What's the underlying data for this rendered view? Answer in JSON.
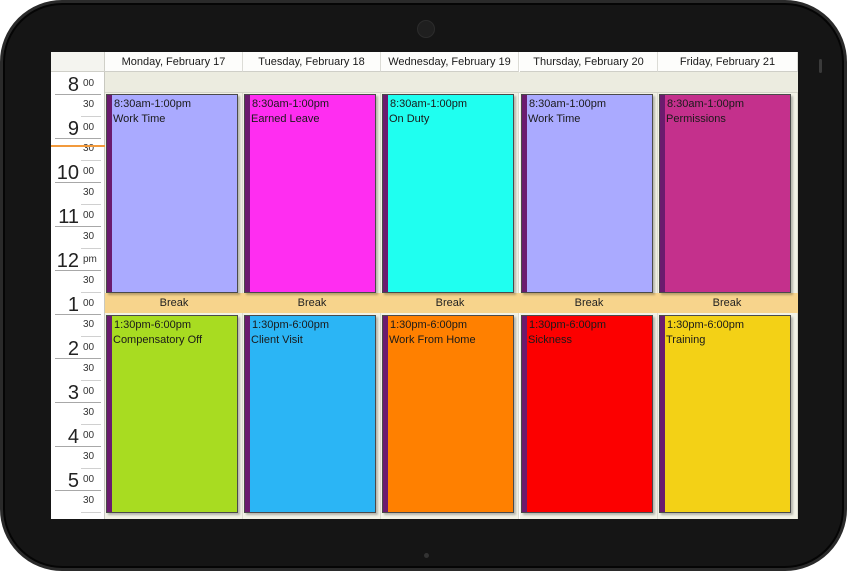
{
  "days": [
    {
      "header": "Monday, February 17",
      "morning": {
        "time": "8:30am-1:00pm",
        "subject": "Work Time",
        "color": "#aaaaff"
      },
      "break": "Break",
      "afternoon": {
        "time": "1:30pm-6:00pm",
        "subject": "Compensatory Off",
        "color": "#a8dc21"
      }
    },
    {
      "header": "Tuesday, February 18",
      "morning": {
        "time": "8:30am-1:00pm",
        "subject": "Earned Leave",
        "color": "#ff2df1"
      },
      "break": "Break",
      "afternoon": {
        "time": "1:30pm-6:00pm",
        "subject": "Client Visit",
        "color": "#2bb5f5"
      }
    },
    {
      "header": "Wednesday, February 19",
      "morning": {
        "time": "8:30am-1:00pm",
        "subject": "On Duty",
        "color": "#1ffff0"
      },
      "break": "Break",
      "afternoon": {
        "time": "1:30pm-6:00pm",
        "subject": "Work From Home",
        "color": "#ff8000"
      }
    },
    {
      "header": "Thursday, February 20",
      "morning": {
        "time": "8:30am-1:00pm",
        "subject": "Work Time",
        "color": "#aaaaff"
      },
      "break": "Break",
      "afternoon": {
        "time": "1:30pm-6:00pm",
        "subject": "Sickness",
        "color": "#fc0000"
      }
    },
    {
      "header": "Friday, February 21",
      "morning": {
        "time": "8:30am-1:00pm",
        "subject": "Permissions",
        "color": "#c4308c"
      },
      "break": "Break",
      "afternoon": {
        "time": "1:30pm-6:00pm",
        "subject": "Training",
        "color": "#f3d116"
      }
    }
  ],
  "ruler": {
    "hours": [
      {
        "num": "8",
        "sup": "00",
        "half": "30"
      },
      {
        "num": "9",
        "sup": "00",
        "half": "30"
      },
      {
        "num": "10",
        "sup": "00",
        "half": "30"
      },
      {
        "num": "11",
        "sup": "00",
        "half": "30"
      },
      {
        "num": "12",
        "sup": "pm",
        "half": "30"
      },
      {
        "num": "1",
        "sup": "00",
        "half": "30"
      },
      {
        "num": "2",
        "sup": "00",
        "half": "30"
      },
      {
        "num": "3",
        "sup": "00",
        "half": "30"
      },
      {
        "num": "4",
        "sup": "00",
        "half": "30"
      },
      {
        "num": "5",
        "sup": "00",
        "half": "30"
      }
    ]
  },
  "colors": {
    "appointment_marker": "#6b1b6e",
    "break_row": "#f7d48c",
    "current_time_line": "#f29a3c",
    "day_background": "#f2f2e6"
  }
}
